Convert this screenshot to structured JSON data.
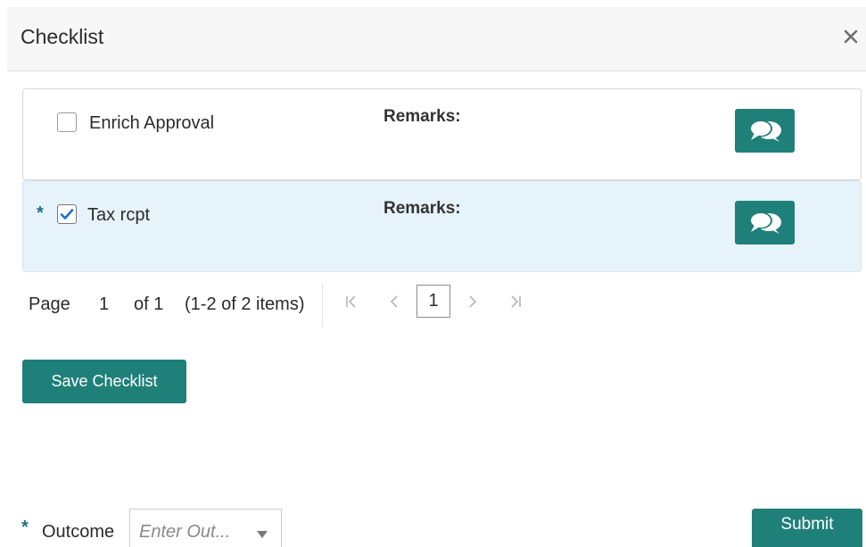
{
  "dialog": {
    "title": "Checklist"
  },
  "checklist": {
    "items": [
      {
        "label": "Enrich Approval",
        "required": false,
        "checked": false,
        "remarks_label": "Remarks:"
      },
      {
        "label": "Tax rcpt",
        "required": true,
        "checked": true,
        "remarks_label": "Remarks:"
      }
    ],
    "required_marker": "*"
  },
  "pagination": {
    "page_label": "Page",
    "page_value": "1",
    "of_label": "of 1",
    "range_label": "(1-2 of 2 items)",
    "current_page": "1"
  },
  "actions": {
    "save_label": "Save Checklist",
    "submit_label": "Submit"
  },
  "outcome": {
    "label": "Outcome",
    "required_marker": "*",
    "placeholder": "Enter Out..."
  },
  "colors": {
    "accent": "#1f8079",
    "selected_row": "#e7f3fa",
    "required_star": "#1f6f8b"
  }
}
